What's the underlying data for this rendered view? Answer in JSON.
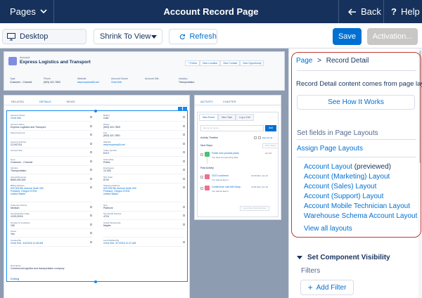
{
  "topbar": {
    "pages_label": "Pages",
    "title": "Account Record Page",
    "back_label": "Back",
    "help_label": "Help"
  },
  "toolbar": {
    "device_label": "Desktop",
    "zoom_label": "Shrink To View",
    "refresh_label": "Refresh",
    "save_label": "Save",
    "activation_label": "Activation..."
  },
  "colors": {
    "nav_bg": "#16325c",
    "brand": "#0070d2",
    "canvas_bg": "#8e9cb2",
    "highlight": "#c23934",
    "disabled": "#c9c7c5"
  },
  "preview": {
    "header": {
      "object_label": "Account",
      "record_name": "Express Logistics and Transport",
      "actions": [
        "+ Follow",
        "New Location",
        "New Contact",
        "New Opportunity"
      ],
      "fields": [
        {
          "label": "Type",
          "value": "Customer - Channel",
          "link": false
        },
        {
          "label": "Phone",
          "value": "(503) 421-7800",
          "link": false
        },
        {
          "label": "Website",
          "value": "www.expressl&t.net",
          "link": true
        },
        {
          "label": "Account Owner",
          "value": "Chris Kirk",
          "link": true
        },
        {
          "label": "Account Site",
          "value": "",
          "link": false
        },
        {
          "label": "Industry",
          "value": "Transportation",
          "link": false
        }
      ]
    },
    "main_tabs": [
      "RELATED",
      "DETAILS",
      "NEWS"
    ],
    "left_fields": [
      {
        "label": "Account Owner",
        "value": "Chris Kirk",
        "link": true
      },
      {
        "label": "Account Name",
        "value": "Express Logistics and Transport",
        "link": false
      },
      {
        "label": "Parent Account",
        "value": "",
        "link": false
      },
      {
        "label": "Account Number",
        "value": "CC947211",
        "link": false
      },
      {
        "label": "Account Site",
        "value": "",
        "link": false
      },
      {
        "label": "Type",
        "value": "Customer - Channel",
        "link": false
      },
      {
        "label": "Industry",
        "value": "Transportation",
        "link": false
      },
      {
        "label": "Annual Revenue",
        "value": "$950,000,000",
        "link": false
      },
      {
        "label": "Billing Address",
        "value": "620 SW 5th Avenue Suite 400 | Portland, Oregon 97204 | United States",
        "link": true,
        "tall": true
      },
      {
        "label": "Customer Priority",
        "value": "Medium",
        "link": false
      },
      {
        "label": "SLA Expiration Date",
        "value": "12/21/2015",
        "link": false
      },
      {
        "label": "Number of Locations",
        "value": "150",
        "link": false
      },
      {
        "label": "Active",
        "value": "Yes",
        "link": false
      },
      {
        "label": "Created By",
        "value": "Chris Kirk, 4/4/2016 11:46 AM",
        "link": true
      }
    ],
    "right_fields": [
      {
        "label": "Rating",
        "value": "Cold",
        "link": false
      },
      {
        "label": "Phone",
        "value": "(503) 421-7800",
        "link": false
      },
      {
        "label": "Fax",
        "value": "(503) 421-7801",
        "link": false
      },
      {
        "label": "Website",
        "value": "www.expressl&t.net",
        "link": true
      },
      {
        "label": "Ticker Symbol",
        "value": "EXLT",
        "link": false
      },
      {
        "label": "Ownership",
        "value": "Public",
        "link": false
      },
      {
        "label": "Employees",
        "value": "12,300",
        "link": false
      },
      {
        "label": "SIC Code",
        "value": "8742",
        "link": false
      },
      {
        "label": "Shipping Address",
        "value": "620 SW 5th Avenue Suite 400 | Portland, Oregon 97204 | United States",
        "link": true,
        "tall": true
      },
      {
        "label": "SLA",
        "value": "Platinum",
        "link": false
      },
      {
        "label": "SLA Serial Number",
        "value": "4724",
        "link": false
      },
      {
        "label": "Upsell Opportunity",
        "value": "Maybe",
        "link": false
      },
      {
        "label": "",
        "value": "",
        "link": false
      },
      {
        "label": "Last Modified By",
        "value": "Chris Kirk, 3/7/2016 11:47 AM",
        "link": true
      }
    ],
    "description_label": "Description",
    "description_value": "Commercial logistics and transportation company",
    "edit_link": "Editing",
    "side_tabs": [
      "ACTIVITY",
      "CHATTER"
    ],
    "activity": {
      "subtabs": [
        "New Event",
        "New Task",
        "Log a Call"
      ],
      "input_placeholder": "Get up on some...",
      "add_label": "Add",
      "timeline_label": "Activity Timeline",
      "expand_label": "Expand All",
      "next_steps": "Next Steps",
      "more_steps": "More Steps",
      "task_title": "Finish new product plans",
      "task_date": "Jun 30",
      "task_meta": "You have an upcoming Task",
      "past_activity": "Past Activity",
      "past_items": [
        {
          "title": "CEO Luncheon",
          "date": "10:00 AM | Jun 21",
          "meta": "You had an Event"
        },
        {
          "title": "Conference call with Dany...",
          "date": "11:00 AM | Jun 15",
          "meta": "You had an Event"
        }
      ],
      "load_more": "Load More Past Activities"
    }
  },
  "panel": {
    "breadcrumb_link": "Page",
    "breadcrumb_sep": ">",
    "breadcrumb_current": "Record Detail",
    "description": "Record Detail content comes from page layouts.",
    "how_button": "See How It Works",
    "set_fields": "Set fields in Page Layouts",
    "assign_link": "Assign Page Layouts",
    "layouts": [
      {
        "label": "Account Layout",
        "note": " (previewed)"
      },
      {
        "label": "Account (Marketing) Layout",
        "note": ""
      },
      {
        "label": "Account (Sales) Layout",
        "note": ""
      },
      {
        "label": "Account (Support) Layout",
        "note": ""
      },
      {
        "label": "Account Mobile Technician Layout",
        "note": ""
      },
      {
        "label": "Warehouse Schema Account Layout",
        "note": ""
      }
    ],
    "view_all": "View all layouts",
    "visibility_heading": "Set Component Visibility",
    "filters_label": "Filters",
    "add_filter": "Add Filter"
  }
}
